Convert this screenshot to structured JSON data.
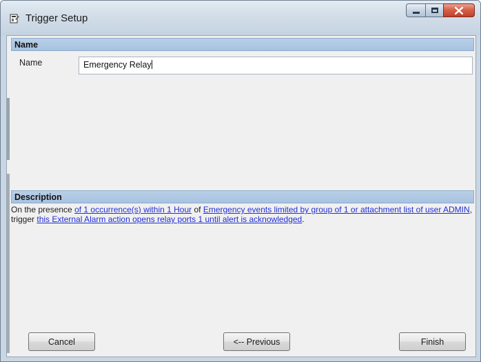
{
  "window": {
    "title": "Trigger Setup",
    "icon": "trigger-setup-icon",
    "caption_buttons": [
      "minimize-icon",
      "maximize-icon",
      "close-icon"
    ]
  },
  "name_section": {
    "header": "Name",
    "label": "Name",
    "value": "Emergency Relay"
  },
  "description_section": {
    "header": "Description",
    "segments": [
      {
        "text": "On the presence ",
        "link": false
      },
      {
        "text": "of 1 occurrence(s) within 1 Hour",
        "link": true
      },
      {
        "text": " of ",
        "link": false
      },
      {
        "text": "Emergency events limited by group of 1 or attachment list of user ADMIN",
        "link": true
      },
      {
        "text": ", trigger ",
        "link": false
      },
      {
        "text": "this External Alarm action opens relay ports 1 until alert is acknowledged",
        "link": true
      },
      {
        "text": ".",
        "link": false
      }
    ]
  },
  "buttons": {
    "cancel": "Cancel",
    "previous": "<-- Previous",
    "finish": "Finish"
  },
  "colors": {
    "section_header": "#a7c2e0",
    "link": "#1f2fd6",
    "close_button": "#c2402a"
  }
}
